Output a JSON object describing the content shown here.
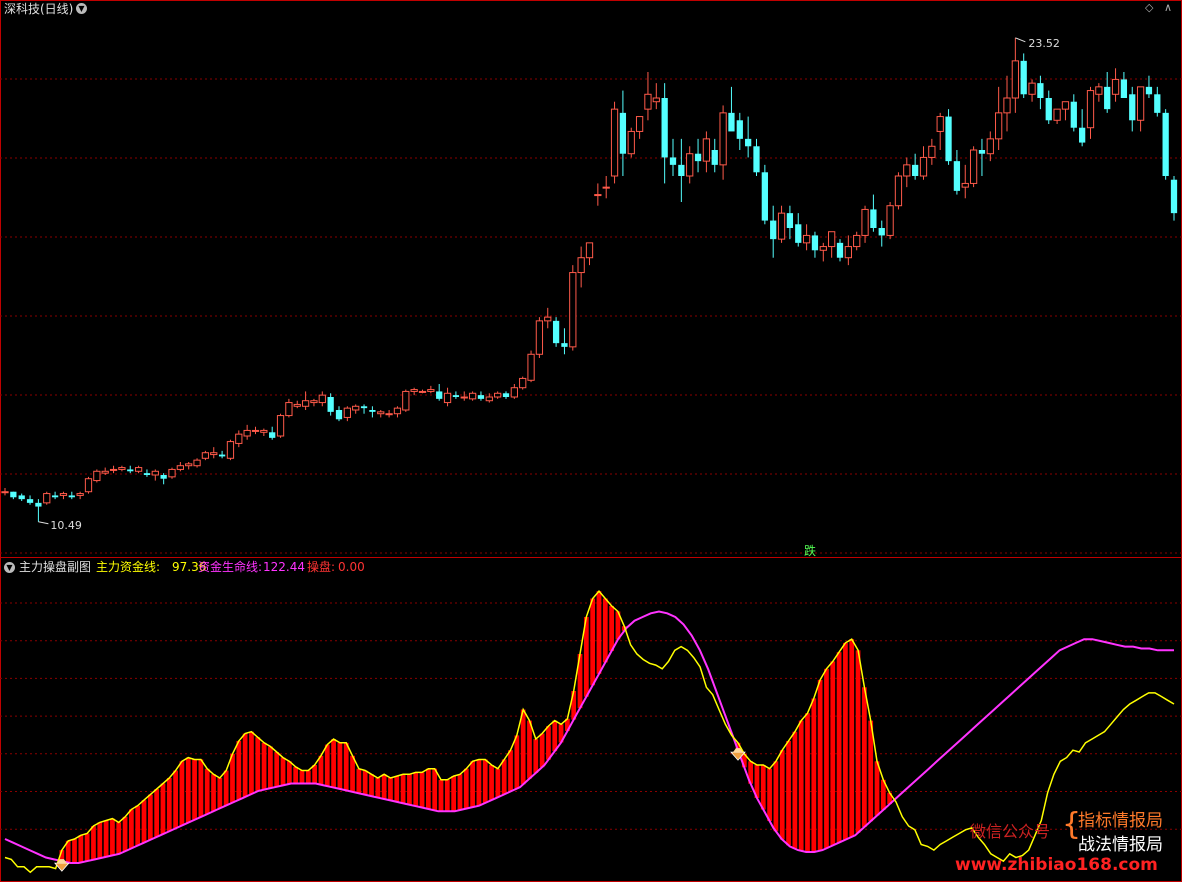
{
  "top_panel": {
    "title": "深科技(日线)",
    "high_label": "23.52",
    "low_label": "10.49",
    "signal_label": "跌"
  },
  "sub_panel": {
    "title": "主力操盘副图",
    "ind1_name": "主力资金线:",
    "ind1_value": "97.36",
    "ind2_name": "资金生命线:",
    "ind2_value": "122.44",
    "ind3_name": "操盘:",
    "ind3_value": "0.00"
  },
  "watermark": {
    "wechat": "微信公众号",
    "line1": "指标情报局",
    "line2": "战法情报局",
    "url": "www.zhibiao168.com"
  },
  "colors": {
    "up": "#ff5a4a",
    "down": "#54ffff",
    "main_line": "#ffff00",
    "life_line": "#ff33ff",
    "bars": "#ff0000",
    "divider": "#c00000"
  },
  "chart_data": [
    {
      "type": "candlestick",
      "title": "深科技(日线)",
      "ylim": [
        10.0,
        24.0
      ],
      "annotations": [
        {
          "text": "23.52",
          "value": 23.52
        },
        {
          "text": "10.49",
          "value": 10.49
        }
      ],
      "ohlc": [
        [
          11.3,
          11.4,
          11.2,
          11.3
        ],
        [
          11.3,
          11.3,
          11.1,
          11.15
        ],
        [
          11.2,
          11.25,
          11.05,
          11.1
        ],
        [
          11.1,
          11.2,
          10.95,
          11.0
        ],
        [
          11.0,
          11.1,
          10.49,
          10.9
        ],
        [
          11.0,
          11.3,
          10.95,
          11.25
        ],
        [
          11.2,
          11.3,
          11.1,
          11.15
        ],
        [
          11.2,
          11.3,
          11.1,
          11.25
        ],
        [
          11.2,
          11.3,
          11.1,
          11.15
        ],
        [
          11.2,
          11.3,
          11.1,
          11.25
        ],
        [
          11.3,
          11.7,
          11.25,
          11.65
        ],
        [
          11.6,
          11.9,
          11.55,
          11.85
        ],
        [
          11.8,
          11.95,
          11.75,
          11.85
        ],
        [
          11.9,
          12.0,
          11.8,
          11.9
        ],
        [
          11.9,
          12.0,
          11.85,
          11.95
        ],
        [
          11.9,
          12.0,
          11.8,
          11.85
        ],
        [
          11.85,
          12.0,
          11.8,
          11.95
        ],
        [
          11.8,
          11.9,
          11.7,
          11.75
        ],
        [
          11.75,
          11.9,
          11.6,
          11.85
        ],
        [
          11.75,
          11.8,
          11.5,
          11.65
        ],
        [
          11.7,
          11.95,
          11.65,
          11.9
        ],
        [
          11.9,
          12.1,
          11.85,
          12.0
        ],
        [
          12.0,
          12.1,
          11.9,
          12.05
        ],
        [
          12.0,
          12.2,
          11.95,
          12.15
        ],
        [
          12.2,
          12.4,
          12.15,
          12.35
        ],
        [
          12.3,
          12.5,
          12.2,
          12.35
        ],
        [
          12.3,
          12.4,
          12.2,
          12.25
        ],
        [
          12.2,
          12.7,
          12.15,
          12.65
        ],
        [
          12.6,
          12.95,
          12.5,
          12.85
        ],
        [
          12.8,
          13.1,
          12.7,
          12.95
        ],
        [
          12.95,
          13.05,
          12.85,
          12.95
        ],
        [
          12.9,
          13.0,
          12.8,
          12.95
        ],
        [
          12.9,
          13.05,
          12.7,
          12.75
        ],
        [
          12.8,
          13.4,
          12.75,
          13.35
        ],
        [
          13.35,
          13.8,
          13.3,
          13.7
        ],
        [
          13.6,
          13.75,
          13.55,
          13.65
        ],
        [
          13.6,
          14.0,
          13.5,
          13.75
        ],
        [
          13.7,
          13.8,
          13.6,
          13.75
        ],
        [
          13.7,
          14.0,
          13.6,
          13.9
        ],
        [
          13.85,
          13.95,
          13.35,
          13.45
        ],
        [
          13.5,
          13.6,
          13.2,
          13.25
        ],
        [
          13.3,
          13.6,
          13.2,
          13.55
        ],
        [
          13.5,
          13.65,
          13.4,
          13.6
        ],
        [
          13.6,
          13.65,
          13.4,
          13.55
        ],
        [
          13.5,
          13.6,
          13.3,
          13.45
        ],
        [
          13.4,
          13.5,
          13.3,
          13.45
        ],
        [
          13.4,
          13.5,
          13.3,
          13.4
        ],
        [
          13.4,
          13.6,
          13.3,
          13.55
        ],
        [
          13.5,
          14.05,
          13.45,
          14.0
        ],
        [
          14.0,
          14.1,
          13.9,
          14.05
        ],
        [
          14.0,
          14.05,
          13.95,
          14.0
        ],
        [
          14.0,
          14.15,
          13.95,
          14.05
        ],
        [
          14.0,
          14.2,
          13.75,
          13.8
        ],
        [
          13.7,
          14.1,
          13.6,
          13.95
        ],
        [
          13.9,
          14.0,
          13.8,
          13.85
        ],
        [
          13.85,
          14.0,
          13.75,
          13.85
        ],
        [
          13.8,
          14.0,
          13.75,
          13.95
        ],
        [
          13.9,
          14.0,
          13.75,
          13.8
        ],
        [
          13.75,
          13.95,
          13.7,
          13.85
        ],
        [
          13.85,
          14.0,
          13.8,
          13.95
        ],
        [
          13.95,
          14.0,
          13.8,
          13.85
        ],
        [
          13.85,
          14.2,
          13.8,
          14.1
        ],
        [
          14.1,
          14.4,
          14.05,
          14.35
        ],
        [
          14.3,
          15.1,
          14.25,
          15.0
        ],
        [
          15.0,
          16.0,
          14.9,
          15.9
        ],
        [
          15.9,
          16.25,
          15.7,
          16.0
        ],
        [
          15.9,
          16.0,
          15.2,
          15.3
        ],
        [
          15.3,
          15.7,
          15.0,
          15.2
        ],
        [
          15.2,
          17.4,
          15.1,
          17.2
        ],
        [
          17.2,
          17.9,
          16.8,
          17.6
        ],
        [
          17.6,
          18.0,
          17.4,
          18.0
        ],
        [
          19.3,
          19.6,
          19.0,
          19.3
        ],
        [
          19.5,
          19.8,
          19.2,
          19.5
        ],
        [
          19.8,
          21.8,
          19.6,
          21.6
        ],
        [
          21.5,
          22.1,
          19.8,
          20.4
        ],
        [
          20.4,
          21.1,
          20.3,
          21.0
        ],
        [
          21.0,
          21.4,
          20.8,
          21.4
        ],
        [
          21.6,
          22.6,
          21.3,
          22.0
        ],
        [
          21.8,
          22.3,
          21.6,
          21.9
        ],
        [
          21.9,
          22.3,
          19.6,
          20.3
        ],
        [
          20.3,
          20.8,
          19.8,
          20.1
        ],
        [
          20.1,
          20.8,
          19.1,
          19.8
        ],
        [
          19.8,
          20.6,
          19.6,
          20.4
        ],
        [
          20.4,
          20.8,
          19.9,
          20.2
        ],
        [
          20.2,
          21.0,
          19.9,
          20.8
        ],
        [
          20.5,
          20.8,
          19.9,
          20.1
        ],
        [
          20.1,
          21.7,
          19.7,
          21.5
        ],
        [
          21.5,
          22.2,
          21.2,
          21.0
        ],
        [
          21.3,
          21.5,
          20.5,
          20.8
        ],
        [
          20.8,
          21.4,
          20.3,
          20.6
        ],
        [
          20.6,
          20.8,
          19.8,
          19.9
        ],
        [
          19.9,
          20.1,
          18.5,
          18.6
        ],
        [
          18.6,
          19.0,
          17.6,
          18.1
        ],
        [
          18.1,
          19.0,
          18.0,
          18.8
        ],
        [
          18.8,
          19.0,
          18.1,
          18.4
        ],
        [
          18.5,
          18.8,
          17.9,
          18.0
        ],
        [
          18.0,
          18.5,
          17.8,
          18.2
        ],
        [
          18.2,
          18.3,
          17.6,
          17.8
        ],
        [
          17.8,
          18.0,
          17.5,
          17.9
        ],
        [
          17.9,
          18.2,
          17.6,
          18.3
        ],
        [
          18.0,
          18.1,
          17.5,
          17.6
        ],
        [
          17.6,
          18.2,
          17.4,
          17.9
        ],
        [
          17.9,
          18.3,
          17.8,
          18.2
        ],
        [
          18.2,
          19.0,
          18.0,
          18.9
        ],
        [
          18.9,
          19.3,
          18.3,
          18.4
        ],
        [
          18.4,
          18.6,
          17.9,
          18.2
        ],
        [
          18.2,
          19.1,
          18.1,
          19.0
        ],
        [
          19.0,
          19.9,
          18.9,
          19.8
        ],
        [
          19.8,
          20.3,
          19.5,
          20.1
        ],
        [
          20.1,
          20.4,
          19.7,
          19.8
        ],
        [
          19.8,
          20.6,
          19.7,
          20.3
        ],
        [
          20.3,
          20.8,
          20.1,
          20.6
        ],
        [
          21.0,
          21.5,
          20.5,
          21.4
        ],
        [
          21.4,
          21.6,
          20.1,
          20.2
        ],
        [
          20.2,
          20.5,
          19.3,
          19.4
        ],
        [
          19.5,
          20.1,
          19.2,
          19.6
        ],
        [
          19.6,
          20.6,
          19.5,
          20.5
        ],
        [
          20.5,
          20.8,
          19.8,
          20.4
        ],
        [
          20.4,
          21.0,
          20.2,
          20.8
        ],
        [
          20.8,
          22.2,
          20.5,
          21.5
        ],
        [
          21.5,
          22.5,
          21.0,
          21.9
        ],
        [
          21.9,
          23.52,
          21.5,
          22.9
        ],
        [
          22.9,
          23.1,
          21.9,
          22.0
        ],
        [
          22.0,
          22.4,
          21.8,
          22.3
        ],
        [
          22.3,
          22.5,
          21.6,
          21.9
        ],
        [
          21.9,
          22.1,
          21.2,
          21.3
        ],
        [
          21.3,
          21.4,
          21.2,
          21.6
        ],
        [
          21.6,
          21.8,
          21.3,
          21.8
        ],
        [
          21.8,
          22.0,
          21.0,
          21.1
        ],
        [
          21.1,
          21.6,
          20.6,
          20.7
        ],
        [
          21.1,
          22.2,
          20.8,
          22.1
        ],
        [
          22.0,
          22.3,
          21.8,
          22.2
        ],
        [
          22.2,
          22.6,
          21.5,
          21.6
        ],
        [
          22.0,
          22.7,
          21.8,
          22.4
        ],
        [
          22.4,
          22.6,
          21.9,
          21.9
        ],
        [
          22.0,
          22.2,
          21.0,
          21.3
        ],
        [
          21.3,
          22.2,
          21.0,
          22.2
        ],
        [
          22.2,
          22.5,
          21.9,
          22.0
        ],
        [
          22.0,
          22.2,
          21.4,
          21.5
        ],
        [
          21.5,
          21.6,
          19.7,
          19.8
        ],
        [
          19.7,
          19.8,
          18.6,
          18.8
        ]
      ]
    },
    {
      "type": "line+bar",
      "title": "主力操盘副图",
      "ylim": [
        0,
        160
      ],
      "series": [
        {
          "name": "主力资金线",
          "values": [
            10,
            9,
            5,
            5,
            2,
            5,
            5,
            5,
            4,
            14,
            19,
            20,
            22,
            23,
            27,
            29,
            30,
            31,
            29,
            32,
            36,
            38,
            41,
            44,
            47,
            50,
            53,
            57,
            62,
            64,
            63,
            63,
            58,
            55,
            53,
            57,
            66,
            73,
            77,
            78,
            75,
            72,
            70,
            67,
            64,
            62,
            59,
            57,
            57,
            60,
            65,
            71,
            74,
            72,
            72,
            65,
            58,
            57,
            55,
            53,
            55,
            53,
            54,
            55,
            55,
            56,
            56,
            58,
            58,
            52,
            52,
            54,
            55,
            58,
            62,
            63,
            63,
            60,
            58,
            63,
            68,
            76,
            90,
            84,
            74,
            77,
            81,
            84,
            82,
            85,
            100,
            120,
            140,
            150,
            154,
            150,
            146,
            143,
            135,
            125,
            120,
            117,
            115,
            114,
            112,
            116,
            122,
            124,
            122,
            118,
            113,
            102,
            98,
            90,
            82,
            76,
            72,
            66,
            62,
            60,
            60,
            58,
            62,
            68,
            73,
            78,
            84,
            88,
            96,
            106,
            112,
            116,
            121,
            126,
            128,
            122,
            102,
            84,
            62,
            52,
            45,
            40,
            32,
            27,
            25,
            17,
            16,
            14,
            17,
            19,
            21,
            23,
            25,
            26,
            21,
            17,
            12,
            10,
            8,
            12,
            10,
            11,
            14,
            22,
            30,
            45,
            55,
            62,
            64,
            68,
            67,
            72,
            74,
            76,
            78,
            82,
            86,
            90,
            93,
            95,
            97,
            99,
            99,
            97,
            95,
            93
          ]
        },
        {
          "name": "资金生命线",
          "values": [
            20,
            18,
            16,
            14,
            12,
            10,
            9,
            8,
            7,
            7,
            8,
            9,
            10,
            11,
            12,
            14,
            16,
            18,
            20,
            22,
            24,
            26,
            28,
            30,
            32,
            34,
            36,
            38,
            40,
            42,
            44,
            46,
            47,
            48,
            49,
            50,
            50,
            50,
            50,
            49,
            48,
            47,
            46,
            45,
            44,
            43,
            42,
            41,
            40,
            39,
            38,
            37,
            36,
            35,
            35,
            35,
            36,
            37,
            38,
            40,
            42,
            44,
            46,
            48,
            52,
            56,
            60,
            66,
            72,
            80,
            88,
            96,
            104,
            112,
            120,
            128,
            134,
            138,
            140,
            142,
            143,
            142,
            140,
            136,
            130,
            122,
            112,
            100,
            88,
            76,
            64,
            52,
            42,
            34,
            26,
            20,
            16,
            14,
            13,
            13,
            14,
            16,
            18,
            20,
            22,
            26,
            30,
            34,
            38,
            42,
            46,
            50,
            54,
            58,
            62,
            66,
            70,
            74,
            78,
            82,
            86,
            90,
            94,
            98,
            102,
            106,
            110,
            114,
            118,
            122,
            124,
            126,
            128,
            128,
            127,
            126,
            125,
            124,
            124,
            123,
            123,
            122,
            122,
            122
          ]
        },
        {
          "name": "操盘",
          "values": [
            0
          ]
        }
      ],
      "markers": "diamond"
    }
  ]
}
